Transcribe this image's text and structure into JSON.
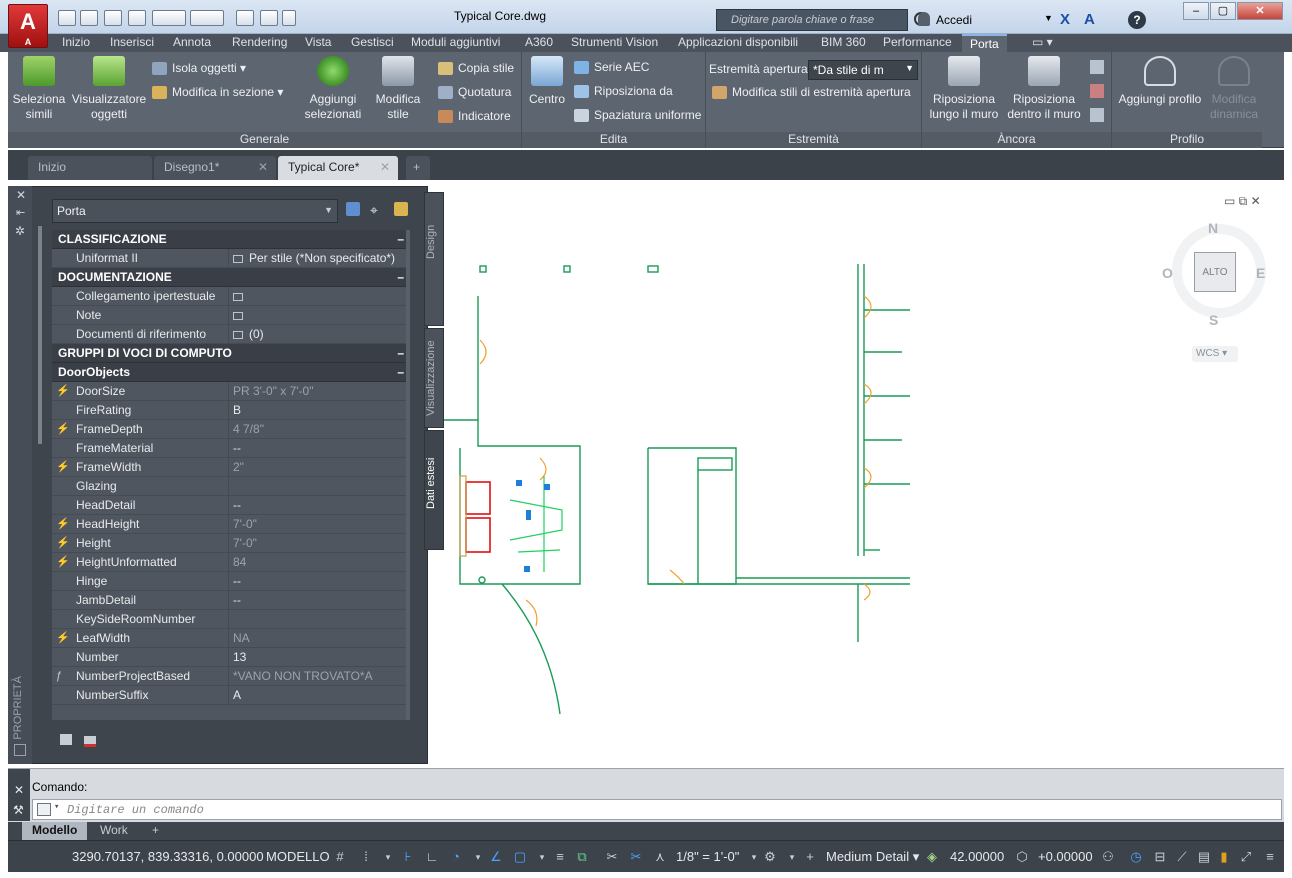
{
  "titlebar": {
    "app_letter": "A",
    "app_sub": "A",
    "doc_title": "Typical Core.dwg",
    "search_placeholder": "Digitare parola chiave o frase",
    "signin_label": "Accedi"
  },
  "ribbon_tabs": [
    "Inizio",
    "Inserisci",
    "Annota",
    "Rendering",
    "Vista",
    "Gestisci",
    "Moduli aggiuntivi",
    "A360",
    "Strumenti Vision",
    "Applicazioni disponibili",
    "BIM 360",
    "Performance",
    "Porta"
  ],
  "ribbon": {
    "generale": {
      "title": "Generale",
      "seleziona_simili": [
        "Seleziona",
        "simili"
      ],
      "visualizzatore": [
        "Visualizzatore",
        "oggetti"
      ],
      "isola_oggetti": "Isola oggetti",
      "modifica_in_sezione": "Modifica in sezione",
      "aggiungi_selezionati": [
        "Aggiungi",
        "selezionati"
      ],
      "modifica_stile": [
        "Modifica",
        "stile"
      ],
      "copia_stile": "Copia stile",
      "quotatura": "Quotatura",
      "indicatore": "Indicatore"
    },
    "edita": {
      "title": "Edita",
      "centro": "Centro",
      "serie_aec": "Serie AEC",
      "riposiziona_da": "Riposiziona da",
      "spaziatura_uniforme": "Spaziatura uniforme"
    },
    "estremita": {
      "title": "Estremità",
      "estremita_apertura": "Estremità apertura",
      "combo_value": "*Da stile di m",
      "modifica_stili": "Modifica stili di estremità apertura"
    },
    "ancora": {
      "title": "Àncora",
      "riposiziona_lungo": [
        "Riposiziona",
        "lungo il muro"
      ],
      "riposiziona_dentro": [
        "Riposiziona",
        "dentro il muro"
      ]
    },
    "profilo": {
      "title": "Profilo",
      "aggiungi_profilo": "Aggiungi profilo",
      "modifica_dinamica": [
        "Modifica",
        "dinamica"
      ]
    }
  },
  "doc_tabs": [
    "Inizio",
    "Disegno1*",
    "Typical Core*"
  ],
  "palette": {
    "style_combo": "Porta",
    "side_label": "PROPRIETÀ",
    "vtabs": [
      "Design",
      "Visualizzazione",
      "Dati estesi"
    ],
    "sections": [
      {
        "title": "CLASSIFICAZIONE",
        "rows": [
          {
            "label": "Uniformat II",
            "value": "Per stile (*Non specificato*)",
            "icon": true
          }
        ]
      },
      {
        "title": "DOCUMENTAZIONE",
        "rows": [
          {
            "label": "Collegamento ipertestuale",
            "value": "",
            "icon": true
          },
          {
            "label": "Note",
            "value": "",
            "icon": true
          },
          {
            "label": "Documenti di riferimento",
            "value": "(0)",
            "icon": true
          }
        ]
      },
      {
        "title": "GRUPPI DI VOCI DI COMPUTO",
        "rows": []
      },
      {
        "title": "DoorObjects",
        "rows": [
          {
            "label": "DoorSize",
            "value": "PR 3'-0\" x 7'-0\"",
            "lightning": true,
            "gray": true
          },
          {
            "label": "FireRating",
            "value": "B"
          },
          {
            "label": "FrameDepth",
            "value": "4 7/8\"",
            "lightning": true,
            "gray": true
          },
          {
            "label": "FrameMaterial",
            "value": "--"
          },
          {
            "label": "FrameWidth",
            "value": "2\"",
            "lightning": true,
            "gray": true
          },
          {
            "label": "Glazing",
            "value": ""
          },
          {
            "label": "HeadDetail",
            "value": "--"
          },
          {
            "label": "HeadHeight",
            "value": "7'-0\"",
            "lightning": true,
            "gray": true
          },
          {
            "label": "Height",
            "value": "7'-0\"",
            "lightning": true,
            "gray": true
          },
          {
            "label": "HeightUnformatted",
            "value": "84",
            "lightning": true,
            "gray": true
          },
          {
            "label": "Hinge",
            "value": "--"
          },
          {
            "label": "JambDetail",
            "value": "--"
          },
          {
            "label": "KeySideRoomNumber",
            "value": ""
          },
          {
            "label": "LeafWidth",
            "value": "NA",
            "lightning": true,
            "gray": true
          },
          {
            "label": "Number",
            "value": "13"
          },
          {
            "label": "NumberProjectBased",
            "value": "*VANO NON TROVATO*A",
            "formula": true,
            "gray": true
          },
          {
            "label": "NumberSuffix",
            "value": "A"
          }
        ]
      }
    ]
  },
  "viewcube": {
    "n": "N",
    "s": "S",
    "e": "E",
    "o": "O",
    "top": "ALTO",
    "wcs": "WCS"
  },
  "command": {
    "history": "Comando:",
    "placeholder": "Digitare un comando"
  },
  "layout_tabs": [
    "Modello",
    "Work"
  ],
  "status": {
    "coords": "3290.70137, 839.33316, 0.00000",
    "space": "MODELLO",
    "scale": "1/8\" = 1'-0\"",
    "detail": "Medium Detail",
    "elevation": "42.00000",
    "offset": "+0.00000"
  }
}
